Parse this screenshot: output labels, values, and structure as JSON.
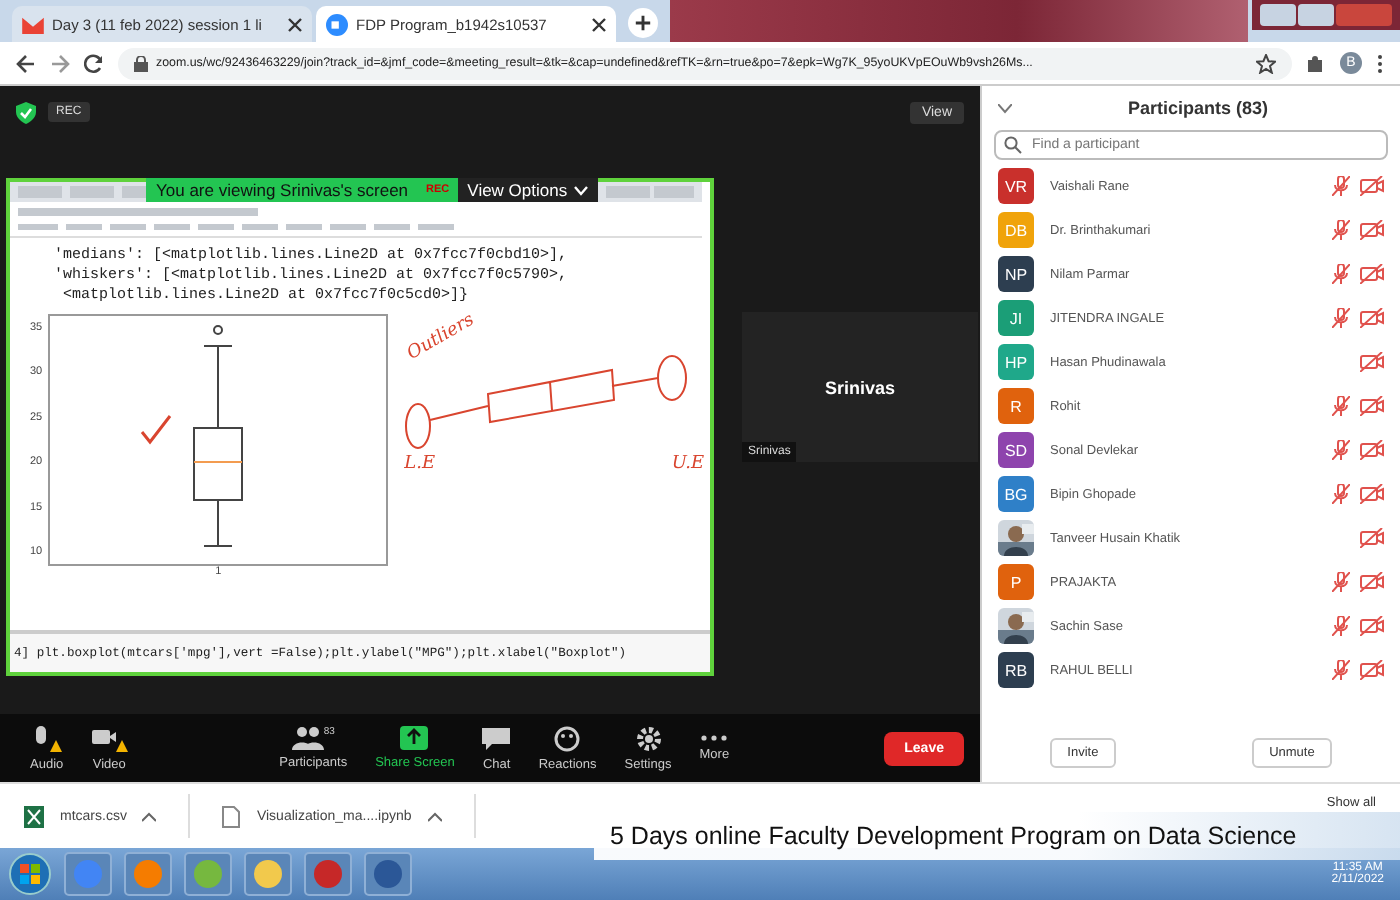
{
  "browser": {
    "tabs": [
      {
        "title": "Day 3 (11 feb 2022) session 1 li",
        "selected": false
      },
      {
        "title": "FDP Program_b1942s10537",
        "selected": true
      }
    ],
    "address": "zoom.us/wc/92436463229/join?track_id=&jmf_code=&meeting_result=&tk=&cap=undefined&refTK=&rn=true&po=7&epk=Wg7K_95yoUKVpEOuWb9vsh26Ms...",
    "profile_initial": "B"
  },
  "meeting": {
    "rec_badge": "REC",
    "view_button": "View",
    "share_banner": {
      "text": "You are viewing Srinivas's screen",
      "rec": "REC",
      "options": "View Options"
    },
    "shared_screen": {
      "code_lines": [
        "'medians': [<matplotlib.lines.Line2D at 0x7fcc7f0cbd10>],",
        "'whiskers': [<matplotlib.lines.Line2D at 0x7fcc7f0c5790>,",
        " <matplotlib.lines.Line2D at 0x7fcc7f0c5cd0>]}"
      ],
      "plot": {
        "y_ticks": [
          "35",
          "30",
          "25",
          "20",
          "15",
          "10"
        ],
        "x_tick": "1"
      },
      "annotations": [
        "Outliers",
        "L.E",
        "U.E"
      ],
      "bottom_code": "4] plt.boxplot(mtcars['mpg'],vert =False);plt.ylabel(\"MPG\");plt.xlabel(\"Boxplot\")"
    },
    "video_tile": {
      "name_large": "Srinivas",
      "name_label": "Srinivas"
    },
    "toolbar": [
      {
        "label": "Audio",
        "kind": "audio"
      },
      {
        "label": "Video",
        "kind": "video"
      },
      {
        "label": "Participants",
        "kind": "participants",
        "badge": "83"
      },
      {
        "label": "Share Screen",
        "kind": "share"
      },
      {
        "label": "Chat",
        "kind": "chat"
      },
      {
        "label": "Reactions",
        "kind": "reactions"
      },
      {
        "label": "Settings",
        "kind": "settings"
      },
      {
        "label": "More",
        "kind": "more"
      }
    ],
    "leave": "Leave"
  },
  "participants": {
    "title": "Participants (83)",
    "search": {
      "placeholder": "Find a participant"
    },
    "items": [
      {
        "name": "Vaishali Rane",
        "initials": "VR",
        "color": "#c9302c",
        "kind": "initials",
        "mic_muted": true
      },
      {
        "name": "Dr. Brinthakumari",
        "initials": "DB",
        "color": "#f0a30a",
        "kind": "initials",
        "mic_muted": true
      },
      {
        "name": "Nilam Parmar",
        "initials": "NP",
        "color": "#2d3e50",
        "kind": "initials",
        "mic_muted": true
      },
      {
        "name": "JITENDRA INGALE",
        "initials": "JI",
        "color": "#1b9e77",
        "kind": "initials",
        "mic_muted": true
      },
      {
        "name": "Hasan Phudinawala",
        "initials": "HP",
        "color": "#1fa88a",
        "kind": "initials",
        "mic_muted": false
      },
      {
        "name": "Rohit",
        "initials": "R",
        "color": "#e0620d",
        "kind": "initials",
        "mic_muted": true
      },
      {
        "name": "Sonal Devlekar",
        "initials": "SD",
        "color": "#8e44ad",
        "kind": "initials",
        "mic_muted": true
      },
      {
        "name": "Bipin Ghopade",
        "initials": "BG",
        "color": "#2f80c8",
        "kind": "initials",
        "mic_muted": true
      },
      {
        "name": "Tanveer Husain Khatik",
        "mic_muted": false
      },
      {
        "name": "PRAJAKTA",
        "initials": "P",
        "color": "#e0620d",
        "kind": "initials",
        "mic_muted": true
      },
      {
        "name": "Sachin Sase",
        "mic_muted": true
      },
      {
        "name": "RAHUL BELLI",
        "initials": "RB",
        "color": "#2d3e50",
        "kind": "initials",
        "mic_muted": true
      }
    ],
    "buttons": [
      "Invite",
      "Unmute"
    ]
  },
  "downloads": {
    "items": [
      {
        "name": "mtcars.csv",
        "kind": "csv"
      },
      {
        "name": "Visualization_ma....ipynb",
        "kind": "file"
      }
    ],
    "show_all": "Show all"
  },
  "caption": "5 Days online Faculty Development Program on Data Science",
  "taskbar": {
    "apps": [
      {
        "kind": "chrome"
      },
      {
        "kind": "firefox"
      },
      {
        "kind": "utorrent"
      },
      {
        "kind": "explorer"
      },
      {
        "kind": "pdf"
      },
      {
        "kind": "word"
      }
    ],
    "time": "11:35 AM",
    "date": "2/11/2022"
  }
}
